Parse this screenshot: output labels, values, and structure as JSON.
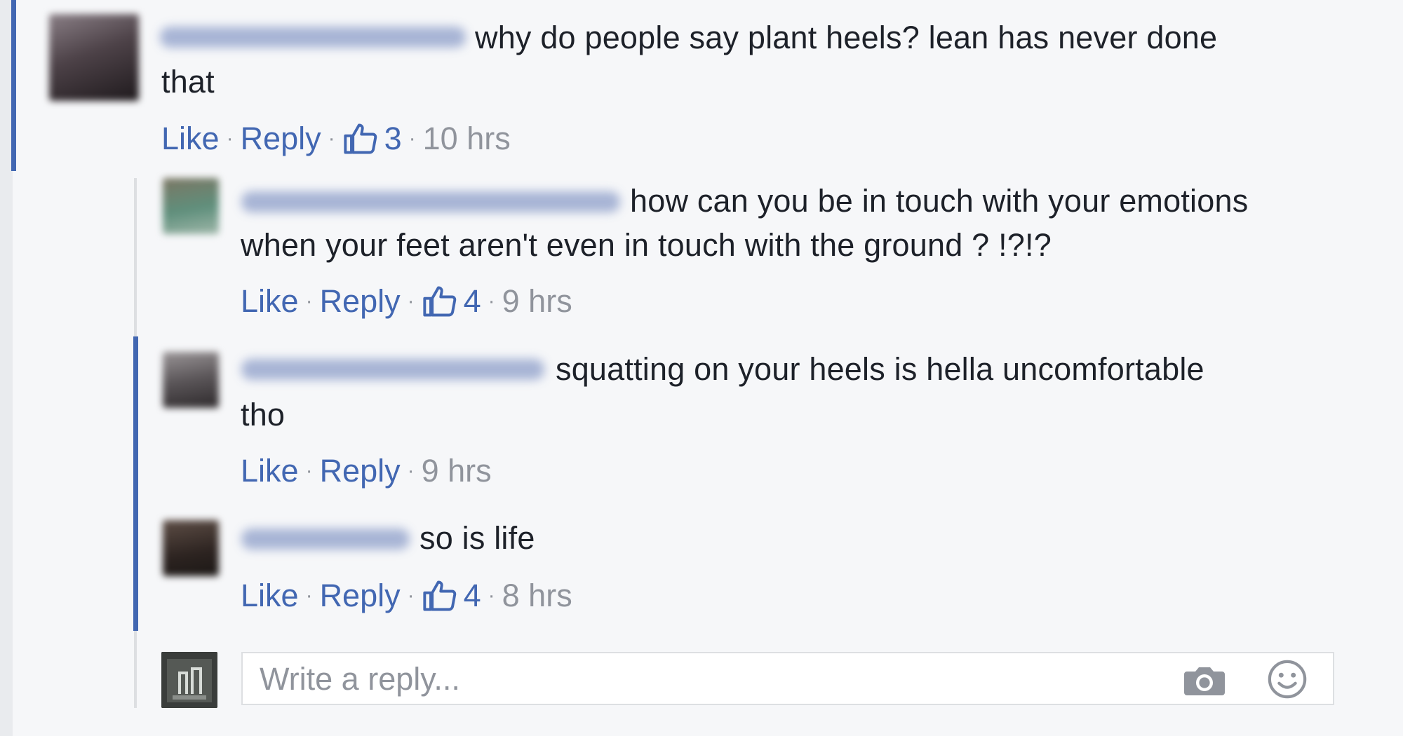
{
  "comments": [
    {
      "text_start": "why do people say plant heels? lean has never done",
      "text_end": "that",
      "like_label": "Like",
      "reply_label": "Reply",
      "like_count": "3",
      "time": "10 hrs"
    },
    {
      "text_start": "how can you be in touch with your emotions",
      "text_end": "when your feet aren't even in touch with the ground ? !?!?",
      "like_label": "Like",
      "reply_label": "Reply",
      "like_count": "4",
      "time": "9 hrs"
    },
    {
      "text_start": "squatting on your heels is hella uncomfortable",
      "text_end": "tho",
      "like_label": "Like",
      "reply_label": "Reply",
      "time": "9 hrs"
    },
    {
      "text_start": "so is life",
      "like_label": "Like",
      "reply_label": "Reply",
      "like_count": "4",
      "time": "8 hrs"
    }
  ],
  "reply_box": {
    "placeholder": "Write a reply..."
  },
  "icons": {
    "like": "thumbs-up-icon",
    "camera": "camera-icon",
    "emoji": "emoji-icon"
  },
  "colors": {
    "link": "#4267b2",
    "meta": "#90949c",
    "text": "#1d2129",
    "background": "#f6f7f9"
  }
}
